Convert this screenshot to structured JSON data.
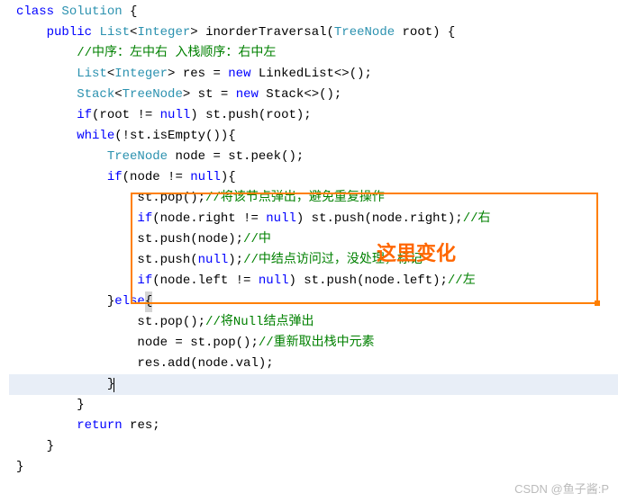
{
  "code": {
    "l1_class": "class",
    "l1_sol": "Solution",
    "l1_brace": " {",
    "l2_indent": "    ",
    "l2_public": "public",
    "l2_sp1": " ",
    "l2_list": "List",
    "l2_lt1": "<",
    "l2_integer": "Integer",
    "l2_gt1": ">",
    "l2_fn": " inorderTraversal(",
    "l2_treenode": "TreeNode",
    "l2_root": " root) {",
    "l3_indent": "        ",
    "l3_comment": "//中序：左中右 入栈顺序：右中左",
    "l4_indent": "        ",
    "l4_list": "List",
    "l4_lt": "<",
    "l4_integer": "Integer",
    "l4_gt": ">",
    "l4_res": " res = ",
    "l4_new": "new",
    "l4_linked": " LinkedList<>();",
    "l5_indent": "        ",
    "l5_stack": "Stack",
    "l5_lt": "<",
    "l5_tn": "TreeNode",
    "l5_gt": ">",
    "l5_st": " st = ",
    "l5_new": "new",
    "l5_stackc": " Stack<>();",
    "l6_indent": "        ",
    "l6_if": "if",
    "l6_cond": "(root != ",
    "l6_null": "null",
    "l6_push": ") st.push(root);",
    "l7_indent": "        ",
    "l7_while": "while",
    "l7_cond": "(!st.isEmpty()){",
    "l8_indent": "            ",
    "l8_tn": "TreeNode",
    "l8_rest": " node = st.peek();",
    "l9_indent": "            ",
    "l9_if": "if",
    "l9_cond": "(node != ",
    "l9_null": "null",
    "l9_brace": "){",
    "l10_indent": "                ",
    "l10_pop": "st.pop();",
    "l10_comment": "//将该节点弹出，避免重复操作",
    "l11_indent": "                ",
    "l11_if": "if",
    "l11_cond": "(node.right != ",
    "l11_null": "null",
    "l11_push": ") st.push(node.right);",
    "l11_comment": "//右",
    "l12_indent": "                ",
    "l12_push": "st.push(node);",
    "l12_comment": "//中",
    "l13_indent": "                ",
    "l13_push": "st.push(",
    "l13_null": "null",
    "l13_close": ");",
    "l13_comment": "//中结点访问过，没处理，标记",
    "l14_indent": "                ",
    "l14_if": "if",
    "l14_cond": "(node.left != ",
    "l14_null": "null",
    "l14_push": ") st.push(node.left);",
    "l14_comment": "//左",
    "l15_indent": "            }",
    "l15_else": "else",
    "l15_brace": "{",
    "l16_indent": "                ",
    "l16_pop": "st.pop();",
    "l16_comment": "//将Null结点弹出",
    "l17_indent": "                ",
    "l17_assign": "node = st.pop();",
    "l17_comment": "//重新取出栈中元素",
    "l18_indent": "                ",
    "l18_add": "res.add(node.val);",
    "l19_indent": "            }",
    "l20_indent": "        }",
    "l21_indent": "        ",
    "l21_return": "return",
    "l21_res": " res;",
    "l22_indent": "    }",
    "l23_brace": "}"
  },
  "annotation": "这里变化",
  "watermark": "CSDN @鱼子酱:P"
}
